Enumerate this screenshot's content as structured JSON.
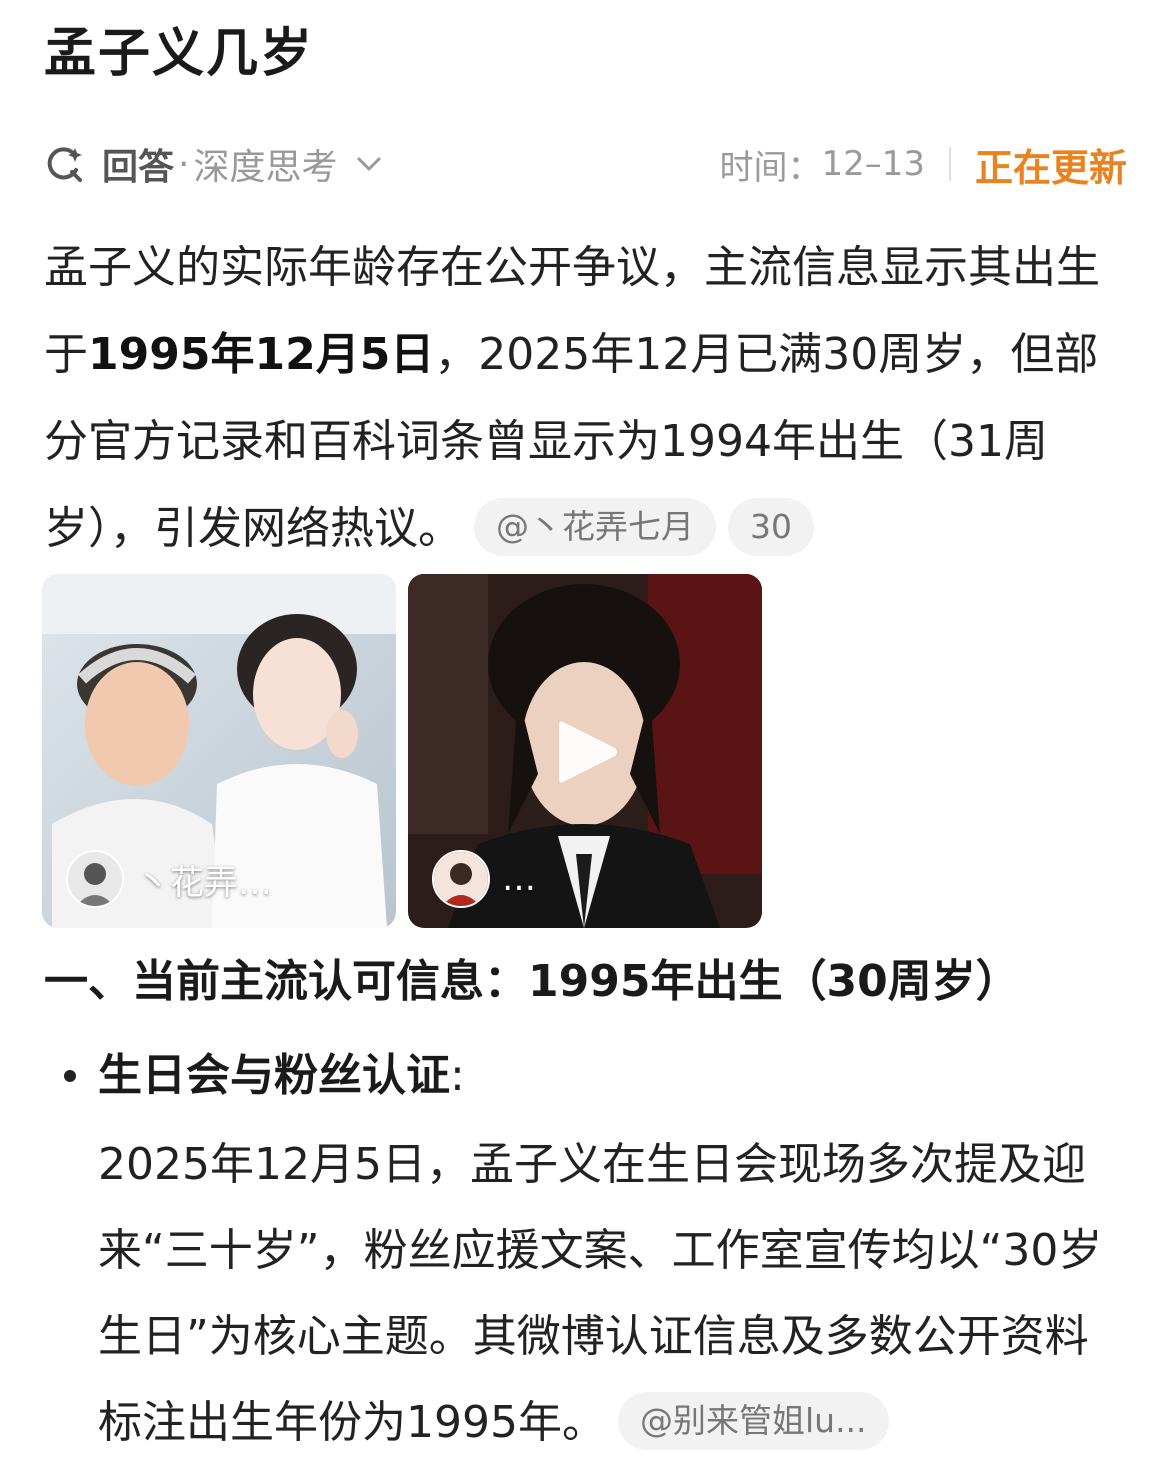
{
  "title": "孟子义几岁",
  "meta": {
    "answer_label": "回答",
    "dot": "·",
    "mode_label": "深度思考",
    "time_prefix": "时间：",
    "time_value": "12–13",
    "status": "正在更新",
    "status_color": "#e8831f"
  },
  "answer": {
    "part1": "孟子义的实际年龄存在公开争议，主流信息显示其出生于",
    "bold1": "1995年12月5日",
    "part2": "，2025年12月已满30周岁，但部分官方记录和百科词条曾显示为1994年出生（31周岁），引发网络热议。",
    "source_chip": "@丶花弄七月",
    "count_chip": "30"
  },
  "media": [
    {
      "author": "丶花弄…",
      "type": "image"
    },
    {
      "author": "…",
      "type": "video"
    }
  ],
  "section1": {
    "heading": "一、当前主流认可信息：1995年出生（30周岁）",
    "bullet_title": "生日会与粉丝认证",
    "bullet_colon": ":",
    "bullet_body": "2025年12月5日，孟子义在生日会现场多次提及迎来“三十岁”，粉丝应援文案、工作室宣传均以“30岁生日”为核心主题。其微博认证信息及多数公开资料标注出生年份为1995年。",
    "source_chip": "@别来管姐lu..."
  },
  "icons": [
    "ai-search-icon",
    "chevron-down-icon",
    "play-icon"
  ]
}
